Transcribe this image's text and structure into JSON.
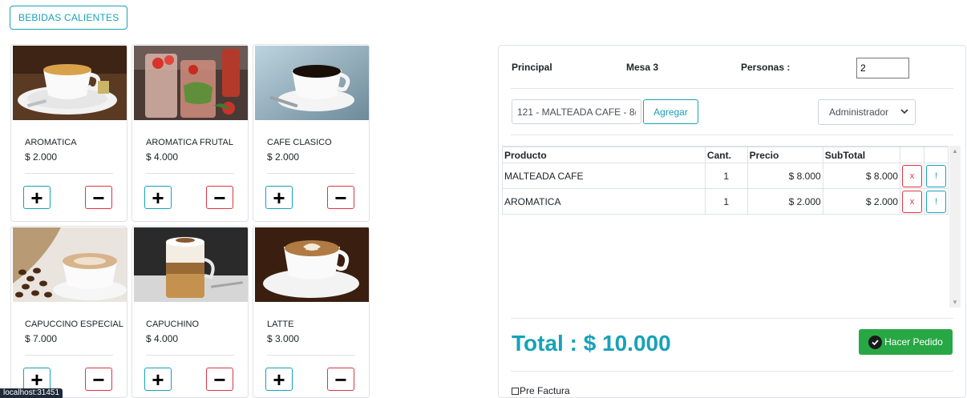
{
  "category": {
    "label": "BEBIDAS CALIENTES"
  },
  "products": [
    {
      "name": "AROMATICA",
      "price": "$ 2.000",
      "image": "tea-cup-photo"
    },
    {
      "name": "AROMATICA FRUTAL",
      "price": "$ 4.000",
      "image": "fruit-tea-photo"
    },
    {
      "name": "CAFE CLASICO",
      "price": "$ 2.000",
      "image": "black-coffee-photo"
    },
    {
      "name": "CAPUCCINO ESPECIAL",
      "price": "$ 7.000",
      "image": "cappuccino-beans-photo"
    },
    {
      "name": "CAPUCHINO",
      "price": "$ 4.000",
      "image": "layered-coffee-glass-photo"
    },
    {
      "name": "LATTE",
      "price": "$ 3.000",
      "image": "latte-art-photo"
    }
  ],
  "product_buttons": {
    "plus": "+",
    "minus": "−"
  },
  "order": {
    "title": "Principal",
    "table": "Mesa 3",
    "persons_label": "Personas :",
    "persons_value": "2",
    "product_input_value": "121 - MALTEADA CAFE - 8(",
    "add_button": "Agregar",
    "user_select": "Administrador",
    "columns": [
      "Producto",
      "Cant.",
      "Precio",
      "SubTotal"
    ],
    "rows": [
      {
        "product": "MALTEADA CAFE",
        "qty": "1",
        "price": "$ 8.000",
        "subtotal": "$ 8.000"
      },
      {
        "product": "AROMATICA",
        "qty": "1",
        "price": "$ 2.000",
        "subtotal": "$ 2.000"
      }
    ],
    "delete_label": "x",
    "info_label": "!",
    "total_label": "Total : $ 10.000",
    "submit_button": "Hacer Pedido",
    "prefactura_label": "Pre Factura"
  },
  "status_bar": "localhost:31451",
  "colors": {
    "info": "#17a2b8",
    "danger": "#dc3545",
    "success": "#28a745"
  }
}
